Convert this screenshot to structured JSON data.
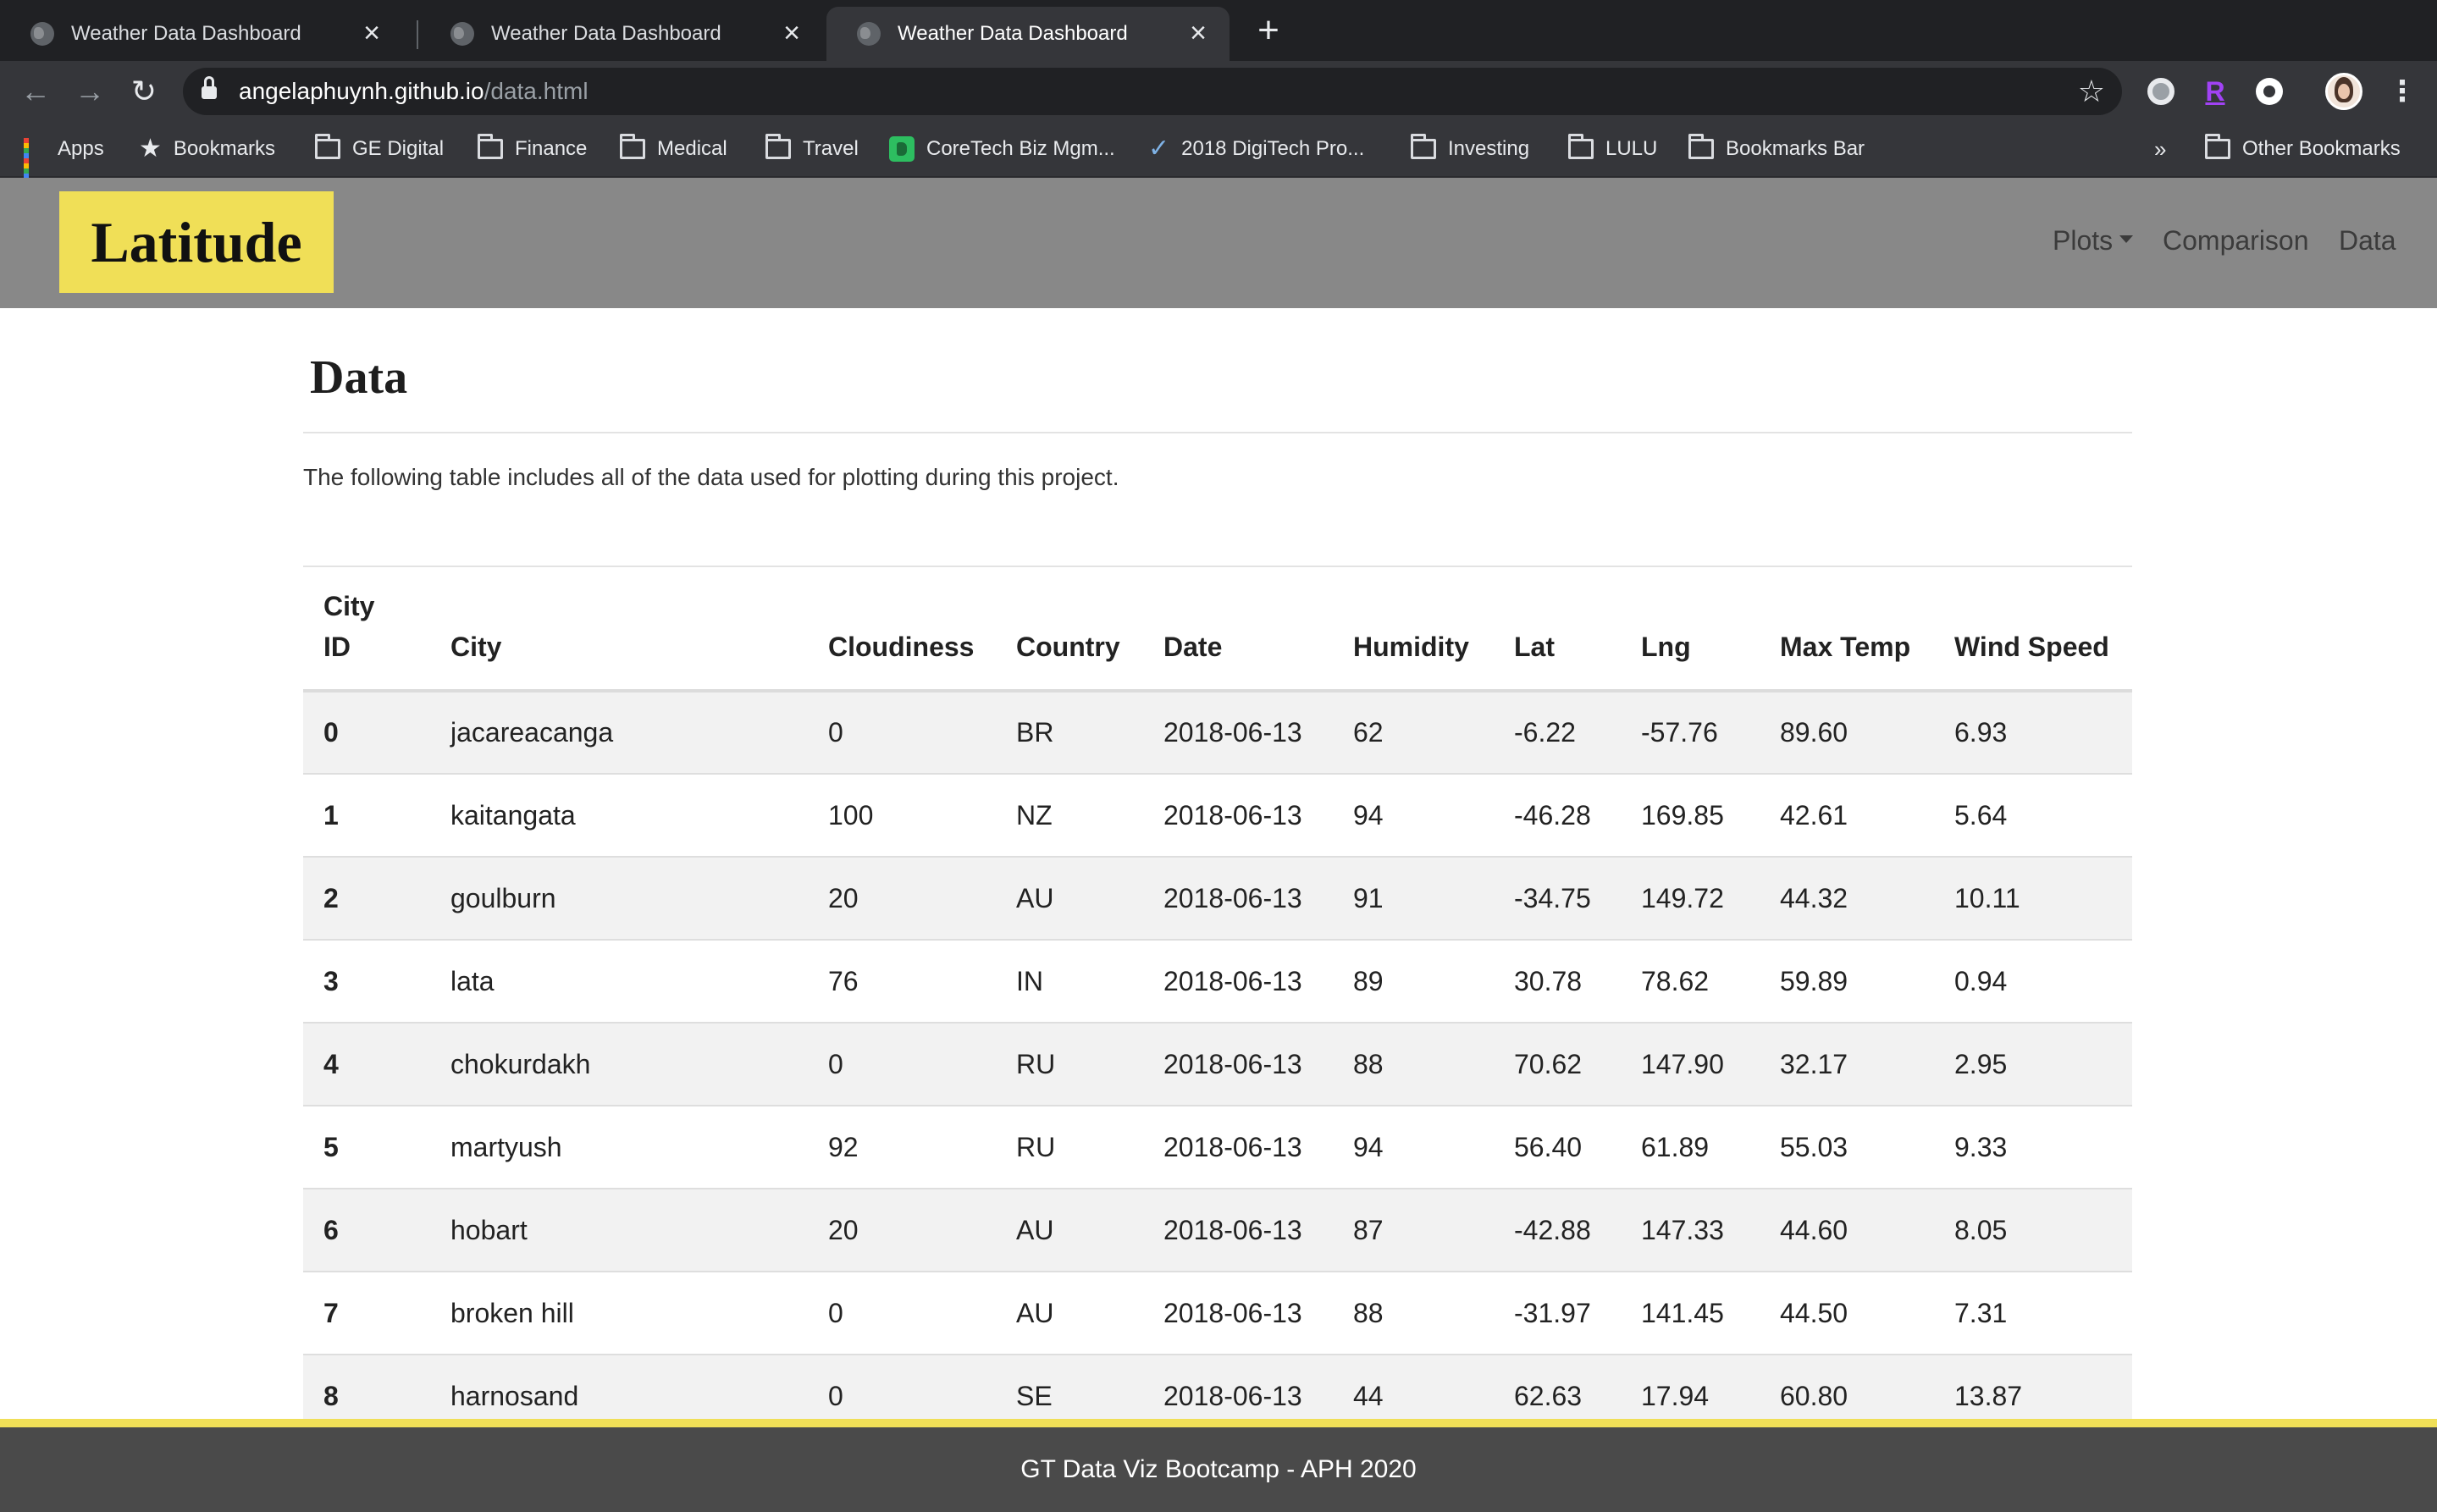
{
  "browser": {
    "tabs": [
      {
        "title": "Weather Data Dashboard",
        "active": false
      },
      {
        "title": "Weather Data Dashboard",
        "active": false
      },
      {
        "title": "Weather Data Dashboard",
        "active": true
      }
    ],
    "url_domain": "angelaphuynh.github.io",
    "url_path": "/data.html",
    "bookmarks": [
      {
        "label": "Apps",
        "icon": "apps-grid-icon"
      },
      {
        "label": "Bookmarks",
        "icon": "star-icon"
      },
      {
        "label": "GE Digital",
        "icon": "folder-icon"
      },
      {
        "label": "Finance",
        "icon": "folder-icon"
      },
      {
        "label": "Medical",
        "icon": "folder-icon"
      },
      {
        "label": "Travel",
        "icon": "folder-icon"
      },
      {
        "label": "CoreTech Biz Mgm...",
        "icon": "evernote-icon"
      },
      {
        "label": "2018 DigiTech Pro...",
        "icon": "checkmark-icon"
      },
      {
        "label": "Investing",
        "icon": "folder-icon"
      },
      {
        "label": "LULU",
        "icon": "folder-icon"
      },
      {
        "label": "Bookmarks Bar",
        "icon": "folder-icon"
      }
    ],
    "overflow": "»",
    "other_bookmarks": "Other Bookmarks"
  },
  "site": {
    "brand": "Latitude",
    "nav": {
      "plots": "Plots",
      "comparison": "Comparison",
      "data": "Data"
    },
    "accent_color": "#f0df57",
    "navbar_color": "#888888"
  },
  "page": {
    "heading": "Data",
    "description": "The following table includes all of the data used for plotting during this project."
  },
  "table": {
    "headers": [
      "City ID",
      "City",
      "Cloudiness",
      "Country",
      "Date",
      "Humidity",
      "Lat",
      "Lng",
      "Max Temp",
      "Wind Speed"
    ],
    "rows": [
      [
        "0",
        "jacareacanga",
        "0",
        "BR",
        "2018-06-13",
        "62",
        "-6.22",
        "-57.76",
        "89.60",
        "6.93"
      ],
      [
        "1",
        "kaitangata",
        "100",
        "NZ",
        "2018-06-13",
        "94",
        "-46.28",
        "169.85",
        "42.61",
        "5.64"
      ],
      [
        "2",
        "goulburn",
        "20",
        "AU",
        "2018-06-13",
        "91",
        "-34.75",
        "149.72",
        "44.32",
        "10.11"
      ],
      [
        "3",
        "lata",
        "76",
        "IN",
        "2018-06-13",
        "89",
        "30.78",
        "78.62",
        "59.89",
        "0.94"
      ],
      [
        "4",
        "chokurdakh",
        "0",
        "RU",
        "2018-06-13",
        "88",
        "70.62",
        "147.90",
        "32.17",
        "2.95"
      ],
      [
        "5",
        "martyush",
        "92",
        "RU",
        "2018-06-13",
        "94",
        "56.40",
        "61.89",
        "55.03",
        "9.33"
      ],
      [
        "6",
        "hobart",
        "20",
        "AU",
        "2018-06-13",
        "87",
        "-42.88",
        "147.33",
        "44.60",
        "8.05"
      ],
      [
        "7",
        "broken hill",
        "0",
        "AU",
        "2018-06-13",
        "88",
        "-31.97",
        "141.45",
        "44.50",
        "7.31"
      ],
      [
        "8",
        "harnosand",
        "0",
        "SE",
        "2018-06-13",
        "44",
        "62.63",
        "17.94",
        "60.80",
        "13.87"
      ]
    ]
  },
  "footer": {
    "text": "GT Data Viz Bootcamp - APH 2020"
  }
}
